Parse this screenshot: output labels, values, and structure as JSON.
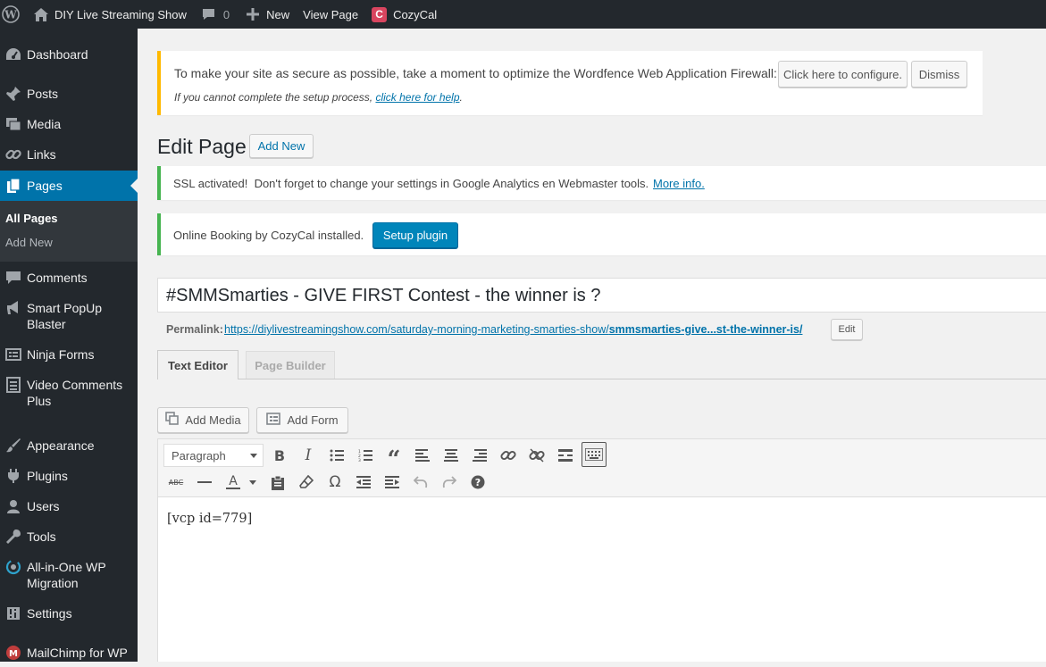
{
  "adminbar": {
    "site_name": "DIY Live Streaming Show",
    "comments_count": "0",
    "new_label": "New",
    "view_page_label": "View Page",
    "cozycal_label": "CozyCal"
  },
  "sidebar": {
    "items": [
      {
        "label": "Dashboard",
        "icon": "dashboard-icon"
      },
      {
        "label": "Posts",
        "icon": "pin-icon"
      },
      {
        "label": "Media",
        "icon": "media-icon"
      },
      {
        "label": "Links",
        "icon": "link-icon"
      },
      {
        "label": "Pages",
        "icon": "page-icon"
      },
      {
        "label": "Comments",
        "icon": "comment-icon"
      },
      {
        "label": "Smart PopUp Blaster",
        "icon": "megaphone-icon"
      },
      {
        "label": "Ninja Forms",
        "icon": "forms-icon"
      },
      {
        "label": "Video Comments Plus",
        "icon": "list-icon"
      },
      {
        "label": "Appearance",
        "icon": "brush-icon"
      },
      {
        "label": "Plugins",
        "icon": "plug-icon"
      },
      {
        "label": "Users",
        "icon": "user-icon"
      },
      {
        "label": "Tools",
        "icon": "wrench-icon"
      },
      {
        "label": "All-in-One WP Migration",
        "icon": "migration-icon"
      },
      {
        "label": "Settings",
        "icon": "settings-icon"
      },
      {
        "label": "MailChimp for WP",
        "icon": "mailchimp-icon"
      }
    ],
    "submenu": [
      "All Pages",
      "Add New"
    ]
  },
  "wordfence": {
    "message": "To make your site as secure as possible, take a moment to optimize the Wordfence Web Application Firewall:",
    "configure_label": "Click here to configure.",
    "dismiss_label": "Dismiss",
    "help_prefix": "If you cannot complete the setup process, ",
    "help_link": "click here for help",
    "help_suffix": "."
  },
  "page_header": {
    "title": "Edit Page",
    "add_new_label": "Add New"
  },
  "ssl_notice": {
    "message": "SSL activated!  Don't forget to change your settings in Google Analytics en Webmaster tools.",
    "link": "More info."
  },
  "cozycal_notice": {
    "message": "Online Booking by CozyCal installed.",
    "button": "Setup plugin"
  },
  "post": {
    "title": "#SMMSmarties - GIVE FIRST Contest - the winner is ?",
    "permalink_label": "Permalink:",
    "permalink_base": "https://diylivestreamingshow.com/saturday-morning-marketing-smarties-show/",
    "permalink_slug": "smmsmarties-give...st-the-winner-is/",
    "edit_label": "Edit"
  },
  "editor": {
    "tabs": [
      "Text Editor",
      "Page Builder"
    ],
    "add_media_label": "Add Media",
    "add_form_label": "Add Form",
    "format_select": "Paragraph",
    "content": "[vcp id=779]"
  },
  "colors": {
    "adminbar_bg": "#23282d",
    "active_menu": "#0073aa",
    "wordfence_border": "#ffb900",
    "success_border": "#46b450",
    "primary_button": "#0085ba"
  }
}
